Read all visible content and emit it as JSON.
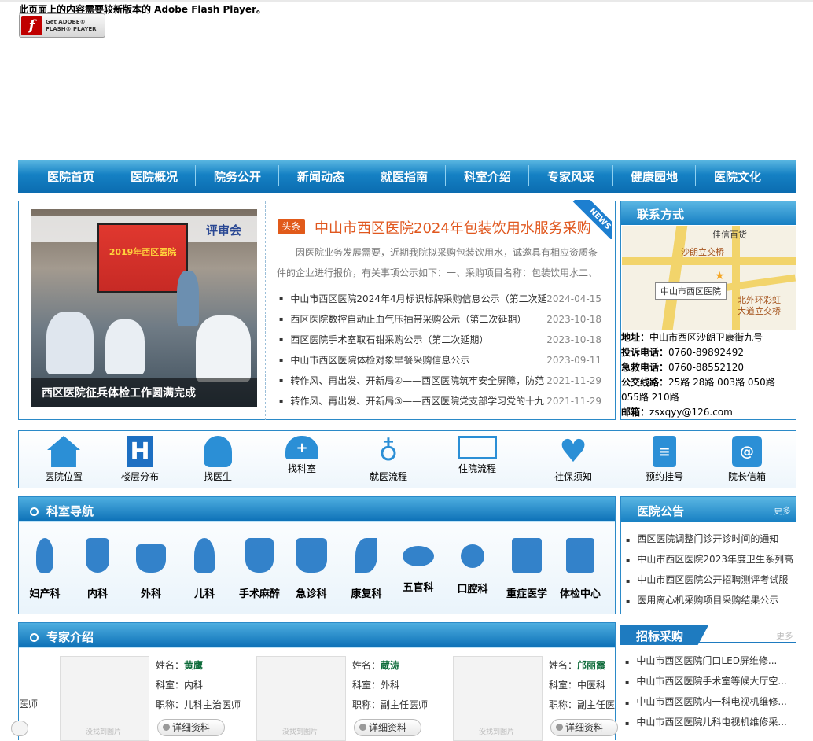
{
  "flash": {
    "message": "此页面上的内容需要较新版本的 Adobe Flash Player。",
    "badge_line1": "Get ADOBE®",
    "badge_line2": "FLASH® PLAYER",
    "logo": "f"
  },
  "nav": [
    "医院首页",
    "医院概况",
    "院务公开",
    "新闻动态",
    "就医指南",
    "科室介绍",
    "专家风采",
    "健康园地",
    "医院文化"
  ],
  "news": {
    "photo_caption": "西区医院征兵体检工作圆满完成",
    "photo_screen_text": "2019年西区医院",
    "photo_banner_text": "评审会",
    "ribbon": "NEWS",
    "headline_tag": "头条",
    "headline": "中山市西区医院2024年包装饮用水服务采购",
    "summary": "因医院业务发展需要，近期我院拟采购包装饮用水，诚邀具有相应资质条件的企业进行报价，有关事项公示如下：一、采购项目名称：包装饮用水二、",
    "items": [
      {
        "title": "中山市西区医院2024年4月标识标牌采购信息公示（第二次延",
        "date": "2024-04-15"
      },
      {
        "title": "西区医院数控自动止血气压抽带采购公示（第二次延期）",
        "date": "2023-10-18"
      },
      {
        "title": "西区医院手术室取石钳采购公示（第二次延期）",
        "date": "2023-10-18"
      },
      {
        "title": "中山市西区医院体检对象早餐采购信息公示",
        "date": "2023-09-11"
      },
      {
        "title": "转作风、再出发、开新局④——西区医院筑牢安全屏障，防范",
        "date": "2021-11-29"
      },
      {
        "title": "转作风、再出发、开新局③——西区医院党支部学习党的十九",
        "date": "2021-11-29"
      }
    ]
  },
  "contact": {
    "title": "联系方式",
    "map": {
      "label1": "佳信百货",
      "label2": "沙朗立交桥",
      "pin": "中山市西区医院",
      "label3": "北外环彩虹",
      "label4": "大道立交桥"
    },
    "lines": [
      {
        "k": "地址：",
        "v": "中山市西区沙朗卫康街九号"
      },
      {
        "k": "投诉电话：",
        "v": "0760-89892492"
      },
      {
        "k": "急救电话：",
        "v": "0760-88552120"
      },
      {
        "k": "公交线路：",
        "v": "25路 28路 003路 050路 055路 210路"
      },
      {
        "k": "邮箱：",
        "v": "zsxqyy@126.com"
      }
    ]
  },
  "quick": [
    "医院位置",
    "楼层分布",
    "找医生",
    "找科室",
    "就医流程",
    "住院流程",
    "社保须知",
    "预约挂号",
    "院长信箱"
  ],
  "departments": {
    "title": "科室导航",
    "items": [
      "妇产科",
      "内科",
      "外科",
      "儿科",
      "手术麻醉",
      "急诊科",
      "康复科",
      "五官科",
      "口腔科",
      "重症医学",
      "体检中心"
    ]
  },
  "notice": {
    "title": "医院公告",
    "more": "更多",
    "items": [
      "西区医院调整门诊开诊时间的通知",
      "中山市西区医院2023年度卫生系列高",
      "中山市西区医院公开招聘测评考试服",
      "医用离心机采购项目采购结果公示"
    ]
  },
  "experts": {
    "title": "专家介绍",
    "partial_left": "医师",
    "photo_placeholder": "没找到图片",
    "detail_label": "详细资料",
    "name_label": "姓名：",
    "dept_label": "科室：",
    "title_label": "职称：",
    "items": [
      {
        "name": "黄鹰",
        "dept": "内科",
        "title": "儿科主治医师"
      },
      {
        "name": "蔵涛",
        "dept": "外科",
        "title": "副主任医师"
      },
      {
        "name": "邝丽霞",
        "dept": "中医科",
        "title": "副主任医"
      }
    ]
  },
  "bidding": {
    "title": "招标采购",
    "more": "更多",
    "items": [
      "中山市西区医院门口LED屏维修...",
      "中山市西区医院手术室等候大厅空...",
      "中山市西区医院内一科电视机维修...",
      "中山市西区医院儿科电视机维修采..."
    ]
  }
}
